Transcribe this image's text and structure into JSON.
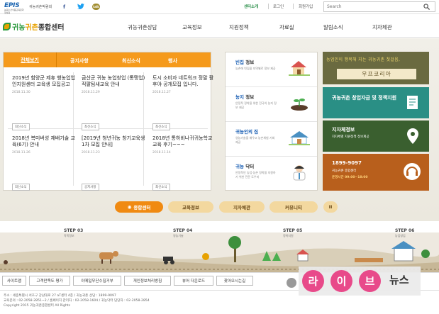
{
  "topbar": {
    "epis_logo": "EPIS",
    "epis_sub": "농림수산식품교육문화정보원",
    "rural_site": "귀농귀촌박람회",
    "sns": {
      "facebook": "f",
      "twitter": "t",
      "kakao": "talk"
    },
    "links": {
      "center": "센터소개",
      "login": "로그인",
      "join": "회원가입"
    },
    "search": {
      "placeholder": "Search"
    }
  },
  "header": {
    "logo": {
      "part1": "귀농",
      "part2": "귀촌",
      "part3": "종합센터"
    },
    "nav": [
      "귀농귀촌상담",
      "교육정보",
      "지원정책",
      "자료실",
      "알림소식",
      "지자체관"
    ]
  },
  "news": {
    "tabs": {
      "all": "전체보기",
      "notice": "공지사항",
      "latest": "최신소식",
      "event": "행사"
    },
    "items": [
      {
        "title": "2019년 함양군 제휴 행농업업인지원센터 교육생 모집공고",
        "date": "2018.11.30",
        "tag": "최신소식"
      },
      {
        "title": "금산군 귀농 농업창업 (통맹업)직팔팀새교육 안내",
        "date": "2018.11.29",
        "tag": "최신소식"
      },
      {
        "title": "도시 소비자 네트워크 정말 활후야 공개모집 입니다.",
        "date": "2018.11.27",
        "tag": "최신소식"
      },
      {
        "title": "2018년 복미버성 재배기술 교육(6기) 안내",
        "date": "2018.11.26",
        "tag": "최신소식"
      },
      {
        "title": "[2019년 청년귀농 창기교육생 1차 모집 안내]",
        "date": "2018.11.23",
        "tag": "공지사항"
      },
      {
        "title": "2018년 통하비나귀귀농학교 교육 후기~~~",
        "date": "2018.11.14",
        "tag": "최신소식"
      }
    ]
  },
  "info": [
    {
      "title": "빈집",
      "title2": " 정보",
      "desc": "농촌에 빈집을 지역별로 정보 제공"
    },
    {
      "title": "농지",
      "title2": " 정보",
      "desc": "안정적 정착을 위한 전국의 농지 정보 제공"
    },
    {
      "title": "귀농인의 집",
      "title2": "",
      "desc": "영농기술을 배우고 농촌체험 기회 제공"
    },
    {
      "title": "귀농",
      "title2": " 닥터",
      "desc": "안정적인 농업·농촌 정착을 지원하기 위한 전문 도우미"
    }
  ],
  "right": {
    "wufu_line1": "농업인이 행복해 지는 귀농귀촌 첫걸음,",
    "wufu_line2": "우프코리아",
    "fund": {
      "title": "귀농귀촌 창업자금 및 정책지원"
    },
    "local": {
      "title": "지자체정보",
      "sub": "지자체별 지원정책 정보제공"
    },
    "call": {
      "number": "1899-9097",
      "sub1": "귀농귀촌 종합센터",
      "sub2": "운영시간 09:00~18:00"
    }
  },
  "quick": {
    "center": "종합센터",
    "edu": "교육정보",
    "local": "지자체관",
    "community": "커뮤니티",
    "pause": "II"
  },
  "steps": [
    {
      "label": "STEP 03",
      "sub": "작목정보"
    },
    {
      "label": "STEP 04",
      "sub": "영농기술"
    },
    {
      "label": "STEP 05",
      "sub": "정착지원"
    },
    {
      "label": "STEP 06",
      "sub": "농업창업"
    }
  ],
  "footer": {
    "links": [
      "사이트맵",
      "고객만족도 평가",
      "이메일무단수집거부",
      "개인정보처리방침",
      "뷰어 다운로드",
      "찾아오시는길"
    ],
    "line1": "주소 : 세종특별시 서초구 강남대로 27 aT센터 4층 / 귀농귀촌 상담 : 1899-9097",
    "line2": "교육문의 : 02-2058-2851~2 / 홈페이지 관리자 : 02-2058-1604 / 귀농닥터 담당자 : 02-2058-2854",
    "copyright": "Copyright 2015 귀농귀촌종합센터 All Rights"
  },
  "watermark": {
    "chars": [
      "라",
      "이",
      "브"
    ],
    "word": "뉴스"
  }
}
